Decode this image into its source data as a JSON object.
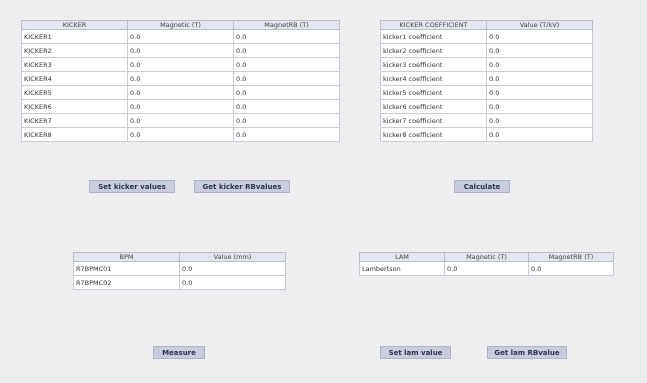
{
  "kicker_table": {
    "headers": [
      "KICKER",
      "Magnetic (T)",
      "MagnetRB (T)"
    ],
    "rows": [
      [
        "KICKER1",
        "0.0",
        "0.0"
      ],
      [
        "KICKER2",
        "0.0",
        "0.0"
      ],
      [
        "KICKER3",
        "0.0",
        "0.0"
      ],
      [
        "KICKER4",
        "0.0",
        "0.0"
      ],
      [
        "KICKER5",
        "0.0",
        "0.0"
      ],
      [
        "KICKER6",
        "0.0",
        "0.0"
      ],
      [
        "KICKER7",
        "0.0",
        "0.0"
      ],
      [
        "KICKER8",
        "0.0",
        "0.0"
      ]
    ]
  },
  "coefficient_table": {
    "headers": [
      "KICKER COEFFICIENT",
      "Value (T/kV)"
    ],
    "rows": [
      [
        "kicker1 coefficient",
        "0.0"
      ],
      [
        "kicker2 coefficient",
        "0.0"
      ],
      [
        "kicker3 coefficient",
        "0.0"
      ],
      [
        "kicker4 coefficient",
        "0.0"
      ],
      [
        "kicker5 coefficient",
        "0.0"
      ],
      [
        "kicker6 coefficient",
        "0.0"
      ],
      [
        "kicker7 coefficient",
        "0.0"
      ],
      [
        "kicker8 coefficient",
        "0.0"
      ]
    ]
  },
  "bpm_table": {
    "headers": [
      "BPM",
      "Value (mm)"
    ],
    "rows": [
      [
        "R7BPMC01",
        "0.0"
      ],
      [
        "R7BPMC02",
        "0.0"
      ]
    ]
  },
  "lam_table": {
    "headers": [
      "LAM",
      "Magnetic (T)",
      "MagnetRB (T)"
    ],
    "rows": [
      [
        "Lambertson",
        "0.0",
        "0.0"
      ]
    ]
  },
  "buttons": {
    "set_kicker": "Set kicker values",
    "get_kicker": "Get kicker RBvalues",
    "calculate": "Calculate",
    "measure": "Measure",
    "set_lam": "Set lam value",
    "get_lam": "Get lam RBvalue"
  }
}
